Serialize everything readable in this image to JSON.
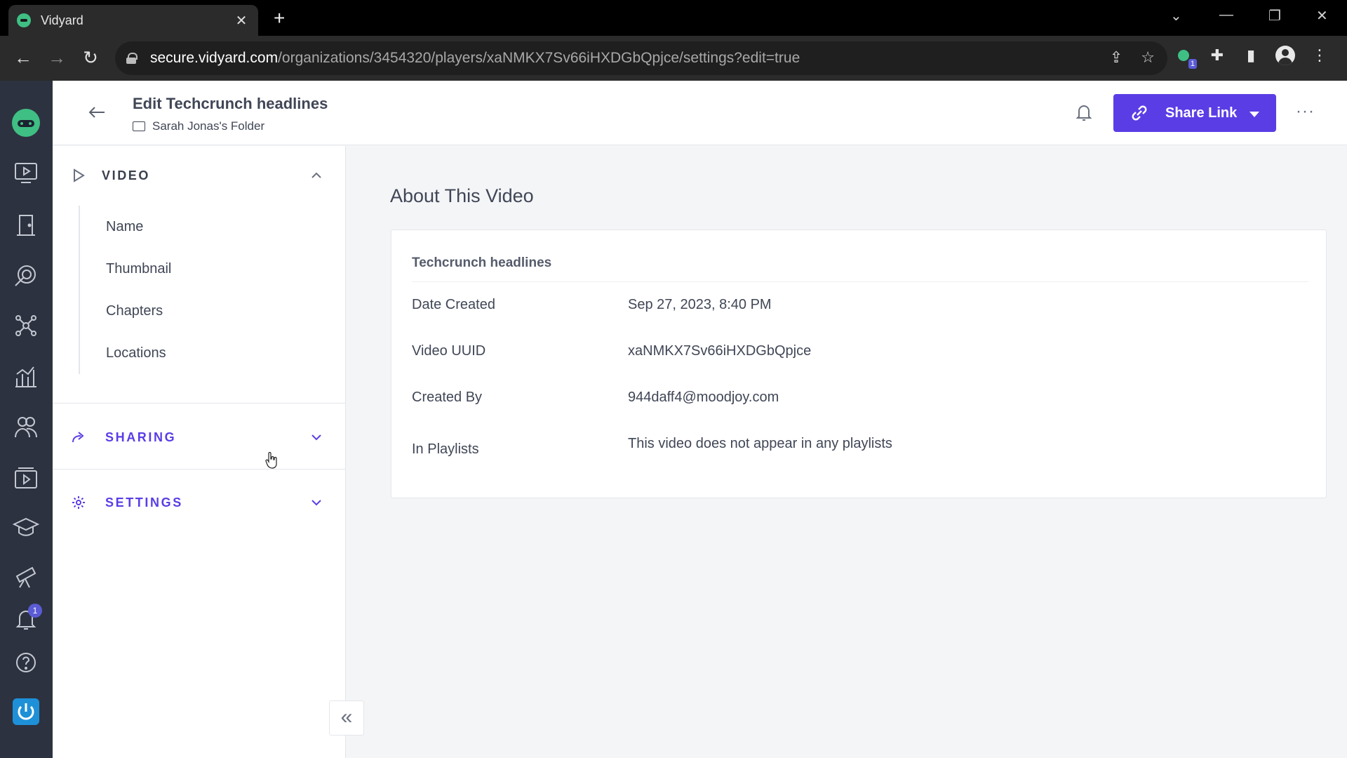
{
  "browser": {
    "tab_title": "Vidyard",
    "tab_close": "✕",
    "new_tab": "+",
    "url_host": "secure.vidyard.com",
    "url_path": "/organizations/3454320/players/xaNMKX7Sv66iHXDGbQpjce/settings?edit=true",
    "extension_badge": "1"
  },
  "rail": {
    "notification_count": "1"
  },
  "header": {
    "title": "Edit Techcrunch headlines",
    "folder": "Sarah Jonas's Folder",
    "share_label": "Share Link",
    "more": "···"
  },
  "sidebar": {
    "video_label": "VIDEO",
    "video_items": [
      "Name",
      "Thumbnail",
      "Chapters",
      "Locations"
    ],
    "sharing_label": "SHARING",
    "settings_label": "SETTINGS",
    "collapse": "«"
  },
  "main": {
    "section_title": "About This Video",
    "card_title": "Techcrunch headlines",
    "rows": [
      {
        "label": "Date Created",
        "value": "Sep 27, 2023, 8:40 PM"
      },
      {
        "label": "Video UUID",
        "value": "xaNMKX7Sv66iHXDGbQpjce"
      },
      {
        "label": "Created By",
        "value": "944daff4@moodjoy.com"
      },
      {
        "label": "In Playlists",
        "value": "This video does not appear in any playlists"
      }
    ]
  },
  "colors": {
    "accent": "#5b3de6",
    "rail_bg": "#2d3240",
    "brand_green": "#3fbf84"
  }
}
